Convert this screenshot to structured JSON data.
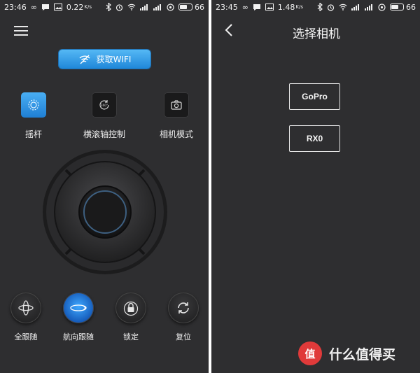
{
  "left_screen": {
    "status": {
      "time": "23:46",
      "net_speed": "0.22",
      "net_unit": "K/s",
      "battery": "66",
      "battery_level": 0.66
    },
    "wifi_button": {
      "label": "获取WIFI"
    },
    "modes": [
      {
        "label": "摇杆",
        "icon": "gear-icon",
        "active": true
      },
      {
        "label": "横滚轴控制",
        "icon": "rotate-360-icon",
        "active": false
      },
      {
        "label": "相机模式",
        "icon": "camera-icon",
        "active": false
      }
    ],
    "actions": [
      {
        "label": "全跟随",
        "icon": "full-follow-icon",
        "active": false
      },
      {
        "label": "航向跟随",
        "icon": "pan-follow-icon",
        "active": true
      },
      {
        "label": "锁定",
        "icon": "lock-icon",
        "active": false
      },
      {
        "label": "复位",
        "icon": "reset-icon",
        "active": false
      }
    ],
    "colors": {
      "background": "#2e2e30",
      "accent": "#2b95e6"
    }
  },
  "right_screen": {
    "status": {
      "time": "23:45",
      "net_speed": "1.48",
      "net_unit": "K/s",
      "battery": "66",
      "battery_level": 0.66
    },
    "title": "选择相机",
    "cameras": [
      {
        "label": "GoPro"
      },
      {
        "label": "RX0"
      }
    ]
  },
  "watermark": {
    "logo_text": "值",
    "text": "什么值得买"
  }
}
